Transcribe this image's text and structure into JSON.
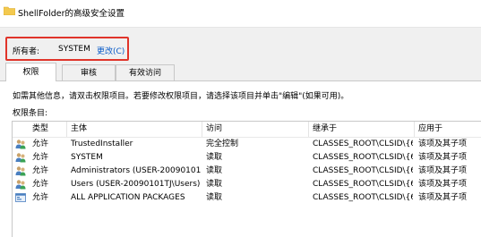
{
  "window": {
    "title": "ShellFolder的高级安全设置",
    "icon": "folder-icon"
  },
  "owner": {
    "label": "所有者:",
    "value": "SYSTEM",
    "change_link": "更改(C)"
  },
  "tabs": [
    {
      "label": "权限",
      "active": true
    },
    {
      "label": "审核",
      "active": false
    },
    {
      "label": "有效访问",
      "active": false
    }
  ],
  "hint": "如需其他信息，请双击权限项目。若要修改权限项目，请选择该项目并单击\"编辑\"(如果可用)。",
  "permissions_label": "权限条目:",
  "table": {
    "columns": [
      "类型",
      "主体",
      "访问",
      "继承于",
      "应用于"
    ],
    "rows": [
      {
        "icon": "users-group-icon",
        "type": "允许",
        "principal": "TrustedInstaller",
        "access": "完全控制",
        "inherited": "CLASSES_ROOT\\CLSID\\{6...",
        "applies": "该项及其子项"
      },
      {
        "icon": "users-group-icon",
        "type": "允许",
        "principal": "SYSTEM",
        "access": "读取",
        "inherited": "CLASSES_ROOT\\CLSID\\{6...",
        "applies": "该项及其子项"
      },
      {
        "icon": "users-group-icon",
        "type": "允许",
        "principal": "Administrators (USER-20090101...",
        "access": "读取",
        "inherited": "CLASSES_ROOT\\CLSID\\{6...",
        "applies": "该项及其子项"
      },
      {
        "icon": "users-group-icon",
        "type": "允许",
        "principal": "Users (USER-20090101TJ\\Users)",
        "access": "读取",
        "inherited": "CLASSES_ROOT\\CLSID\\{6...",
        "applies": "该项及其子项"
      },
      {
        "icon": "app-packages-icon",
        "type": "允许",
        "principal": "ALL APPLICATION PACKAGES",
        "access": "读取",
        "inherited": "CLASSES_ROOT\\CLSID\\{6...",
        "applies": "该项及其子项"
      }
    ]
  },
  "colors": {
    "highlight_border": "#e0342a",
    "link": "#0a5bc8",
    "dialog_bg": "#f0f0f0"
  }
}
